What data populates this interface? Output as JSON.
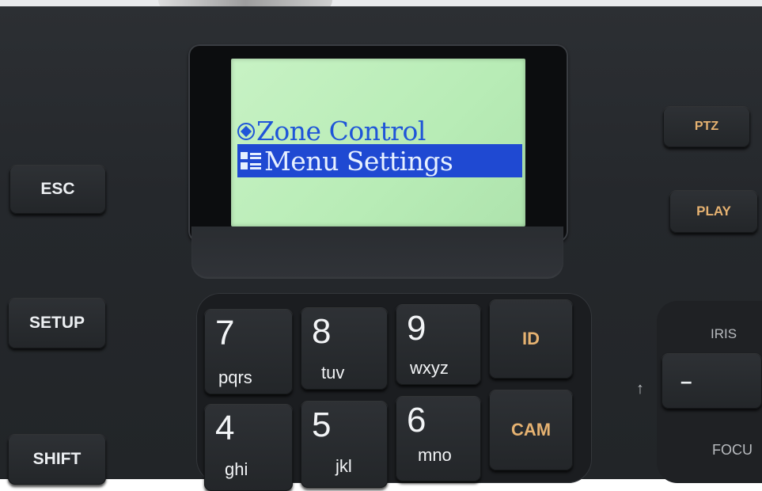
{
  "lcd": {
    "row1": "Zone Control",
    "row2": "Menu Settings",
    "row1_icon": "radio-selected-icon",
    "row2_icon": "menu-grid-icon",
    "highlight_color": "#1f49d2",
    "text_color": "#1f55d8",
    "background_color": "#bdeebb"
  },
  "left_keys": {
    "esc": "ESC",
    "setup": "SETUP",
    "shift": "SHIFT"
  },
  "right_keys": {
    "ptz": "PTZ",
    "play": "PLAY",
    "iris_label": "IRIS",
    "iris_minus": "–",
    "focus_label": "FOCU",
    "arrow": "↑"
  },
  "keypad": {
    "k7": {
      "digit": "7",
      "letters": "pqrs"
    },
    "k8": {
      "digit": "8",
      "letters": "tuv"
    },
    "k9": {
      "digit": "9",
      "letters": "wxyz"
    },
    "k4": {
      "digit": "4",
      "letters": "ghi"
    },
    "k5": {
      "digit": "5",
      "letters": "jkl"
    },
    "k6": {
      "digit": "6",
      "letters": "mno"
    },
    "id": "ID",
    "cam": "CAM"
  }
}
